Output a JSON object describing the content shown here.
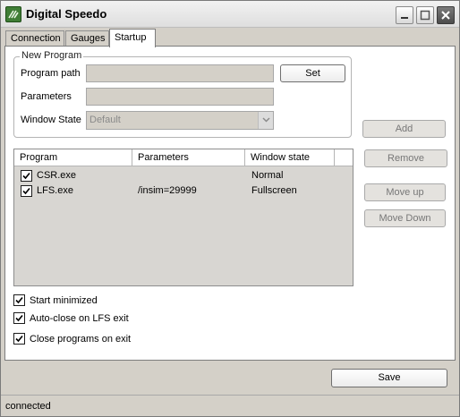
{
  "window": {
    "title": "Digital Speedo",
    "controls": {
      "minimize_icon": "minimize-icon",
      "maximize_icon": "maximize-icon",
      "close_icon": "close-icon"
    }
  },
  "tabs": [
    {
      "label": "Connection",
      "active": false
    },
    {
      "label": "Gauges",
      "active": false
    },
    {
      "label": "Startup",
      "active": true
    }
  ],
  "new_program": {
    "group_title": "New Program",
    "program_path_label": "Program path",
    "program_path_value": "",
    "parameters_label": "Parameters",
    "parameters_value": "",
    "window_state_label": "Window State",
    "window_state_value": "Default",
    "set_label": "Set"
  },
  "side_buttons": {
    "add": "Add",
    "remove": "Remove",
    "move_up": "Move up",
    "move_down": "Move Down"
  },
  "program_list": {
    "columns": [
      "Program",
      "Parameters",
      "Window state"
    ],
    "rows": [
      {
        "checked": true,
        "program": "CSR.exe",
        "parameters": "",
        "window_state": "Normal"
      },
      {
        "checked": true,
        "program": "LFS.exe",
        "parameters": "/insim=29999",
        "window_state": "Fullscreen"
      }
    ]
  },
  "options": [
    {
      "label": "Start minimized",
      "checked": true
    },
    {
      "label": "Auto-close on LFS exit",
      "checked": true
    },
    {
      "label": "Close programs on exit",
      "checked": true
    }
  ],
  "footer": {
    "save_label": "Save"
  },
  "status": {
    "text": "connected"
  },
  "colors": {
    "window_bg": "#d4d0c8",
    "panel_bg": "#ffffff",
    "icon_green": "#3f7d35"
  }
}
